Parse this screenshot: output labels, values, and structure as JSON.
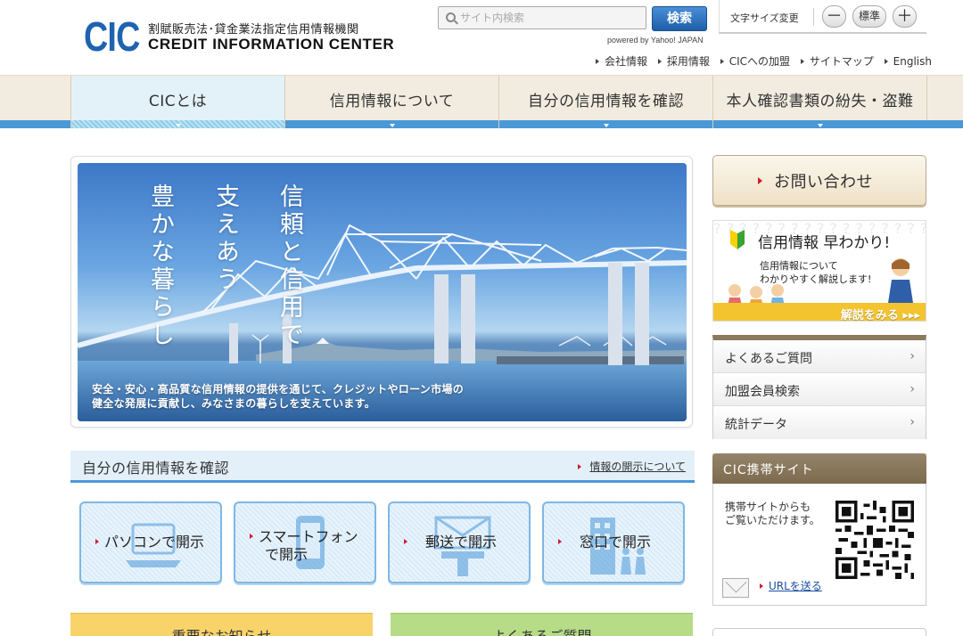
{
  "logo": {
    "mark": "CIC",
    "jp": "割賦販売法･貸金業法指定信用情報機関",
    "en": "CREDIT INFORMATION CENTER"
  },
  "search": {
    "placeholder": "サイト内検索",
    "button": "検索",
    "powered": "powered by Yahoo! JAPAN"
  },
  "font_size": {
    "label": "文字サイズ変更",
    "minus": "－",
    "standard": "標準",
    "plus": "＋"
  },
  "utility_nav": [
    "会社情報",
    "採用情報",
    "CICへの加盟",
    "サイトマップ",
    "English"
  ],
  "global_nav": [
    {
      "label": "CICとは",
      "active": true
    },
    {
      "label": "信用情報について",
      "active": false
    },
    {
      "label": "自分の信用情報を確認",
      "active": false
    },
    {
      "label": "本人確認書類の紛失・盗難",
      "active": false
    }
  ],
  "hero": {
    "copy": [
      "信頼と信用で",
      "支えあう",
      "豊かな暮らし"
    ],
    "caption_line1": "安全・安心・高品質な信用情報の提供を通じて、クレジットやローン市場の",
    "caption_line2": "健全な発展に貢献し、みなさまの暮らしを支えています。"
  },
  "check": {
    "title": "自分の信用情報を確認",
    "link": "情報の開示について",
    "tiles": [
      {
        "label": "パソコンで開示",
        "icon": "laptop-icon"
      },
      {
        "label_1": "スマートフォン",
        "label_2": "で開示",
        "icon": "smartphone-icon"
      },
      {
        "label": "郵送で開示",
        "icon": "mailbox-icon"
      },
      {
        "label": "窓口で開示",
        "icon": "building-icon"
      }
    ]
  },
  "sections": {
    "notice": "重要なお知らせ",
    "faq": "よくあるご質問"
  },
  "sidebar": {
    "contact": "お問い合わせ",
    "quick": {
      "title": "信用情報 早わかり!",
      "sub_1": "信用情報について",
      "sub_2": "わかりやすく解説します!",
      "cta": "解説をみる ▸▸▸"
    },
    "links": [
      "よくあるご質問",
      "加盟会員検索",
      "統計データ"
    ],
    "mobile": {
      "title": "CIC携帯サイト",
      "text_1": "携帯サイトからも",
      "text_2": "ご覧いただけます。",
      "link": "URLを送る"
    }
  },
  "colors": {
    "brand_blue": "#1e63b1",
    "nav_blue": "#4a98d8",
    "nav_beige": "#f2ece0",
    "accent_red": "#d0192f",
    "quick_yellow": "#f3c42f",
    "mobile_brown": "#7c6a4f"
  }
}
